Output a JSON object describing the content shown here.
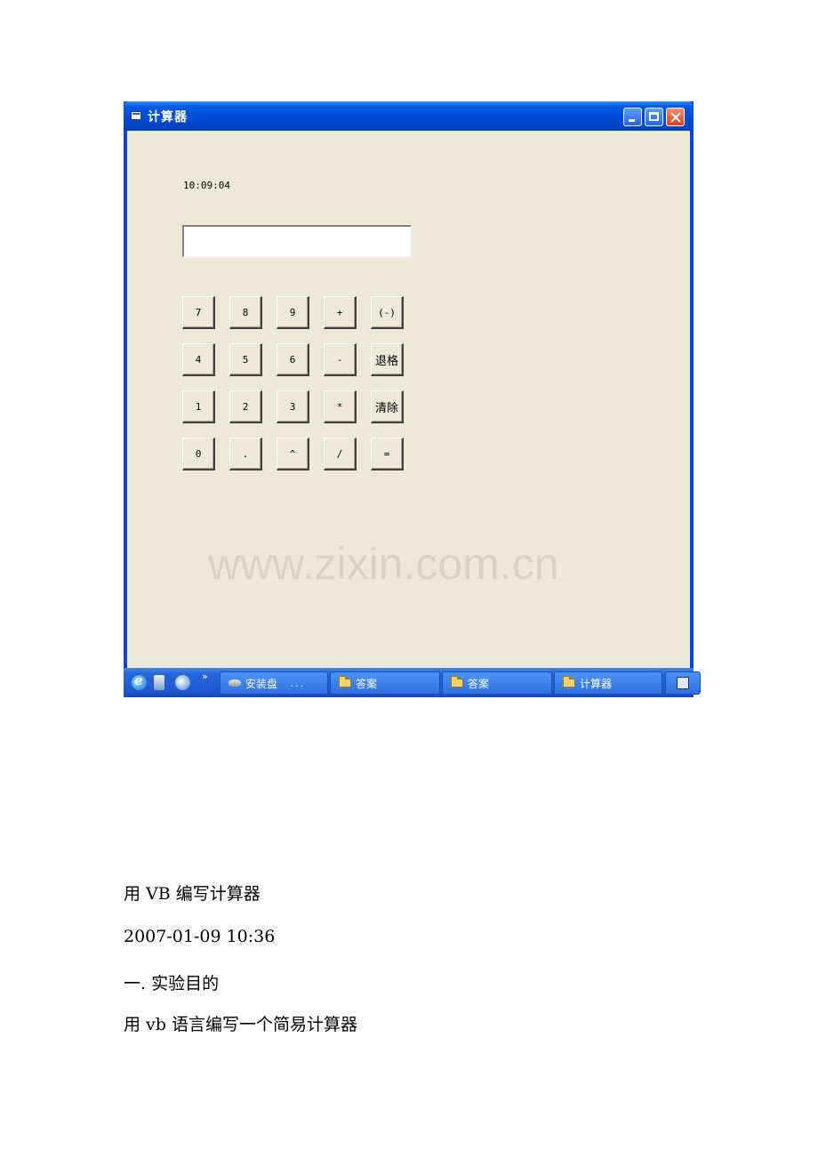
{
  "window": {
    "title": "计算器",
    "clock": "10:09:04",
    "display_value": "",
    "keys": [
      [
        "7",
        "8",
        "9",
        "+",
        "(-)"
      ],
      [
        "4",
        "5",
        "6",
        "-",
        "退格"
      ],
      [
        "1",
        "2",
        "3",
        "*",
        "清除"
      ],
      [
        "0",
        ".",
        "^",
        "/",
        "="
      ]
    ],
    "watermark": "www.zixin.com.cn"
  },
  "taskbar": {
    "chevron": "»",
    "tasks": [
      {
        "label": "安装盘",
        "suffix": "...",
        "icon": "disk-icon"
      },
      {
        "label": "答案",
        "icon": "folder-icon"
      },
      {
        "label": "答案",
        "icon": "folder-icon"
      },
      {
        "label": "计算器",
        "icon": "folder-icon"
      },
      {
        "label": "",
        "icon": "app-icon"
      }
    ]
  },
  "document": {
    "heading": "用 VB 编写计算器",
    "date": "2007-01-09 10:36",
    "section": "一. 实验目的",
    "body": "用 vb 语言编写一个简易计算器"
  },
  "colors": {
    "titlebar": "#0058e6",
    "client_bg": "#ece9d8",
    "taskbar": "#2058d0"
  }
}
